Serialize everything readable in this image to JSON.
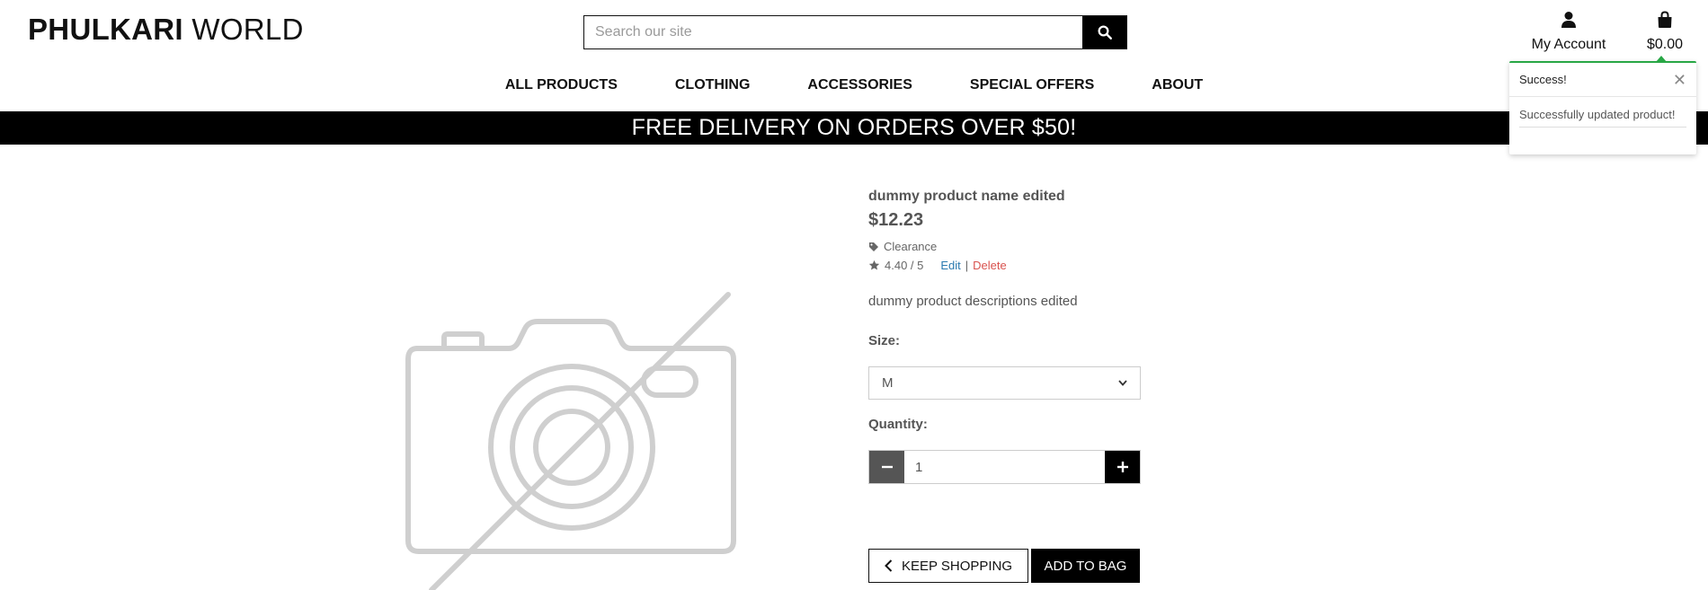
{
  "header": {
    "logo_bold": "PHULKARI",
    "logo_light": "WORLD",
    "search_placeholder": "Search our site",
    "account_label": "My Account",
    "cart_total": "$0.00"
  },
  "nav": {
    "items": [
      "ALL PRODUCTS",
      "CLOTHING",
      "ACCESSORIES",
      "SPECIAL OFFERS",
      "ABOUT"
    ]
  },
  "banner": {
    "text": "FREE DELIVERY ON ORDERS OVER $50!"
  },
  "product": {
    "name": "dummy product name edited",
    "price": "$12.23",
    "category": "Clearance",
    "rating": "4.40 / 5",
    "edit_label": "Edit",
    "separator": "|",
    "delete_label": "Delete",
    "description": "dummy product descriptions edited",
    "size_label": "Size:",
    "size_value": "M",
    "quantity_label": "Quantity:",
    "quantity_value": "1",
    "keep_shopping_label": "KEEP SHOPPING",
    "add_to_bag_label": "ADD TO BAG"
  },
  "toast": {
    "title": "Success!",
    "close": "✕",
    "message": "Successfully updated product!",
    "accent_color": "#28a745"
  },
  "icons": {
    "search": "search-icon",
    "account": "user-icon",
    "cart": "shopping-bag-icon",
    "tag": "tag-icon",
    "star": "star-icon",
    "minus": "minus-icon",
    "plus": "plus-icon",
    "chevron": "chevron-left-icon",
    "no_image": "no-image-camera-icon"
  }
}
